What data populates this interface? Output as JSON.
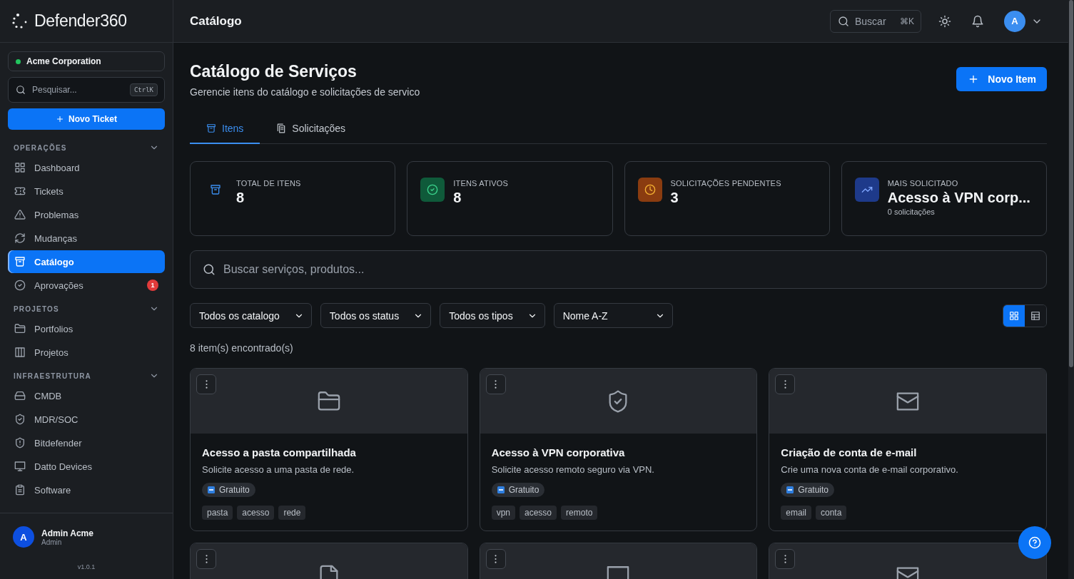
{
  "brand": {
    "name": "Defender360"
  },
  "organization": {
    "name": "Acme Corporation",
    "color": "#22c55e"
  },
  "sidebar_search": {
    "placeholder": "Pesquisar...",
    "shortcut": "CtrlK"
  },
  "new_ticket": "Novo Ticket",
  "sections": [
    {
      "title": "OPERAÇÕES",
      "expanded": true,
      "items": [
        {
          "label": "Dashboard",
          "kind": "grid",
          "selected": false
        },
        {
          "label": "Tickets",
          "kind": "ticket",
          "selected": false
        },
        {
          "label": "Problemas",
          "kind": "alert",
          "selected": false
        },
        {
          "label": "Mudanças",
          "kind": "refresh",
          "selected": false
        },
        {
          "label": "Catálogo",
          "kind": "archive",
          "selected": true
        },
        {
          "label": "Aprovações",
          "kind": "check",
          "selected": false,
          "badge": "1"
        }
      ]
    },
    {
      "title": "PROJETOS",
      "expanded": true,
      "items": [
        {
          "label": "Portfolios",
          "kind": "folder",
          "selected": false
        },
        {
          "label": "Projetos",
          "kind": "columns",
          "selected": false
        }
      ]
    },
    {
      "title": "INFRAESTRUTURA",
      "expanded": true,
      "items": [
        {
          "label": "CMDB",
          "kind": "drive",
          "selected": false
        },
        {
          "label": "MDR/SOC",
          "kind": "shieldcheck",
          "selected": false
        },
        {
          "label": "Bitdefender",
          "kind": "shieldalert",
          "selected": false
        },
        {
          "label": "Datto Devices",
          "kind": "monitor",
          "selected": false
        },
        {
          "label": "Software",
          "kind": "clipboard",
          "selected": false
        }
      ]
    }
  ],
  "user": {
    "initial": "A",
    "name": "Admin Acme",
    "role": "Admin"
  },
  "version": "v1.0.1",
  "header": {
    "title": "Catálogo",
    "search": {
      "placeholder": "Buscar",
      "shortcut": "⌘K"
    },
    "avatar": "A"
  },
  "page": {
    "title": "Catálogo de Serviços",
    "subtitle": "Gerencie itens do catálogo e solicitações de servico",
    "new_button": "Novo Item"
  },
  "tabs": [
    {
      "label": "Itens",
      "kind": "archive",
      "selected": true
    },
    {
      "label": "Solicitações",
      "kind": "files",
      "selected": false
    }
  ],
  "stats": [
    {
      "label": "TOTAL DE ITENS",
      "value": "8",
      "kind": "total"
    },
    {
      "label": "ITENS ATIVOS",
      "value": "8",
      "kind": "active"
    },
    {
      "label": "SOLICITAÇÕES PENDENTES",
      "value": "3",
      "kind": "pending"
    },
    {
      "label": "MAIS SOLICITADO",
      "value": "Acesso à VPN corp...",
      "kind": "top",
      "note": "0 solicitações"
    }
  ],
  "search": {
    "placeholder": "Buscar serviços, produtos..."
  },
  "filters": [
    "Todos os catalogo",
    "Todos os status",
    "Todos os tipos",
    "Nome A-Z"
  ],
  "view_toggle": [
    {
      "kind": "grid",
      "selected": true
    },
    {
      "kind": "table",
      "selected": false
    }
  ],
  "count": "8 item(s) encontrado(s)",
  "items": [
    {
      "kind": "folder",
      "title": "Acesso a pasta compartilhada",
      "description": "Solicite acesso a uma pasta de rede.",
      "price": "Gratuito",
      "tags": [
        "pasta",
        "acesso",
        "rede"
      ]
    },
    {
      "kind": "shieldcheck",
      "title": "Acesso à VPN corporativa",
      "description": "Solicite acesso remoto seguro via VPN.",
      "price": "Gratuito",
      "tags": [
        "vpn",
        "acesso",
        "remoto"
      ]
    },
    {
      "kind": "mail",
      "title": "Criação de conta de e-mail",
      "description": "Crie uma nova conta de e-mail corporativo.",
      "price": "Gratuito",
      "tags": [
        "email",
        "conta"
      ]
    },
    {
      "kind": "file"
    },
    {
      "kind": "monitor"
    },
    {
      "kind": "mail"
    }
  ]
}
